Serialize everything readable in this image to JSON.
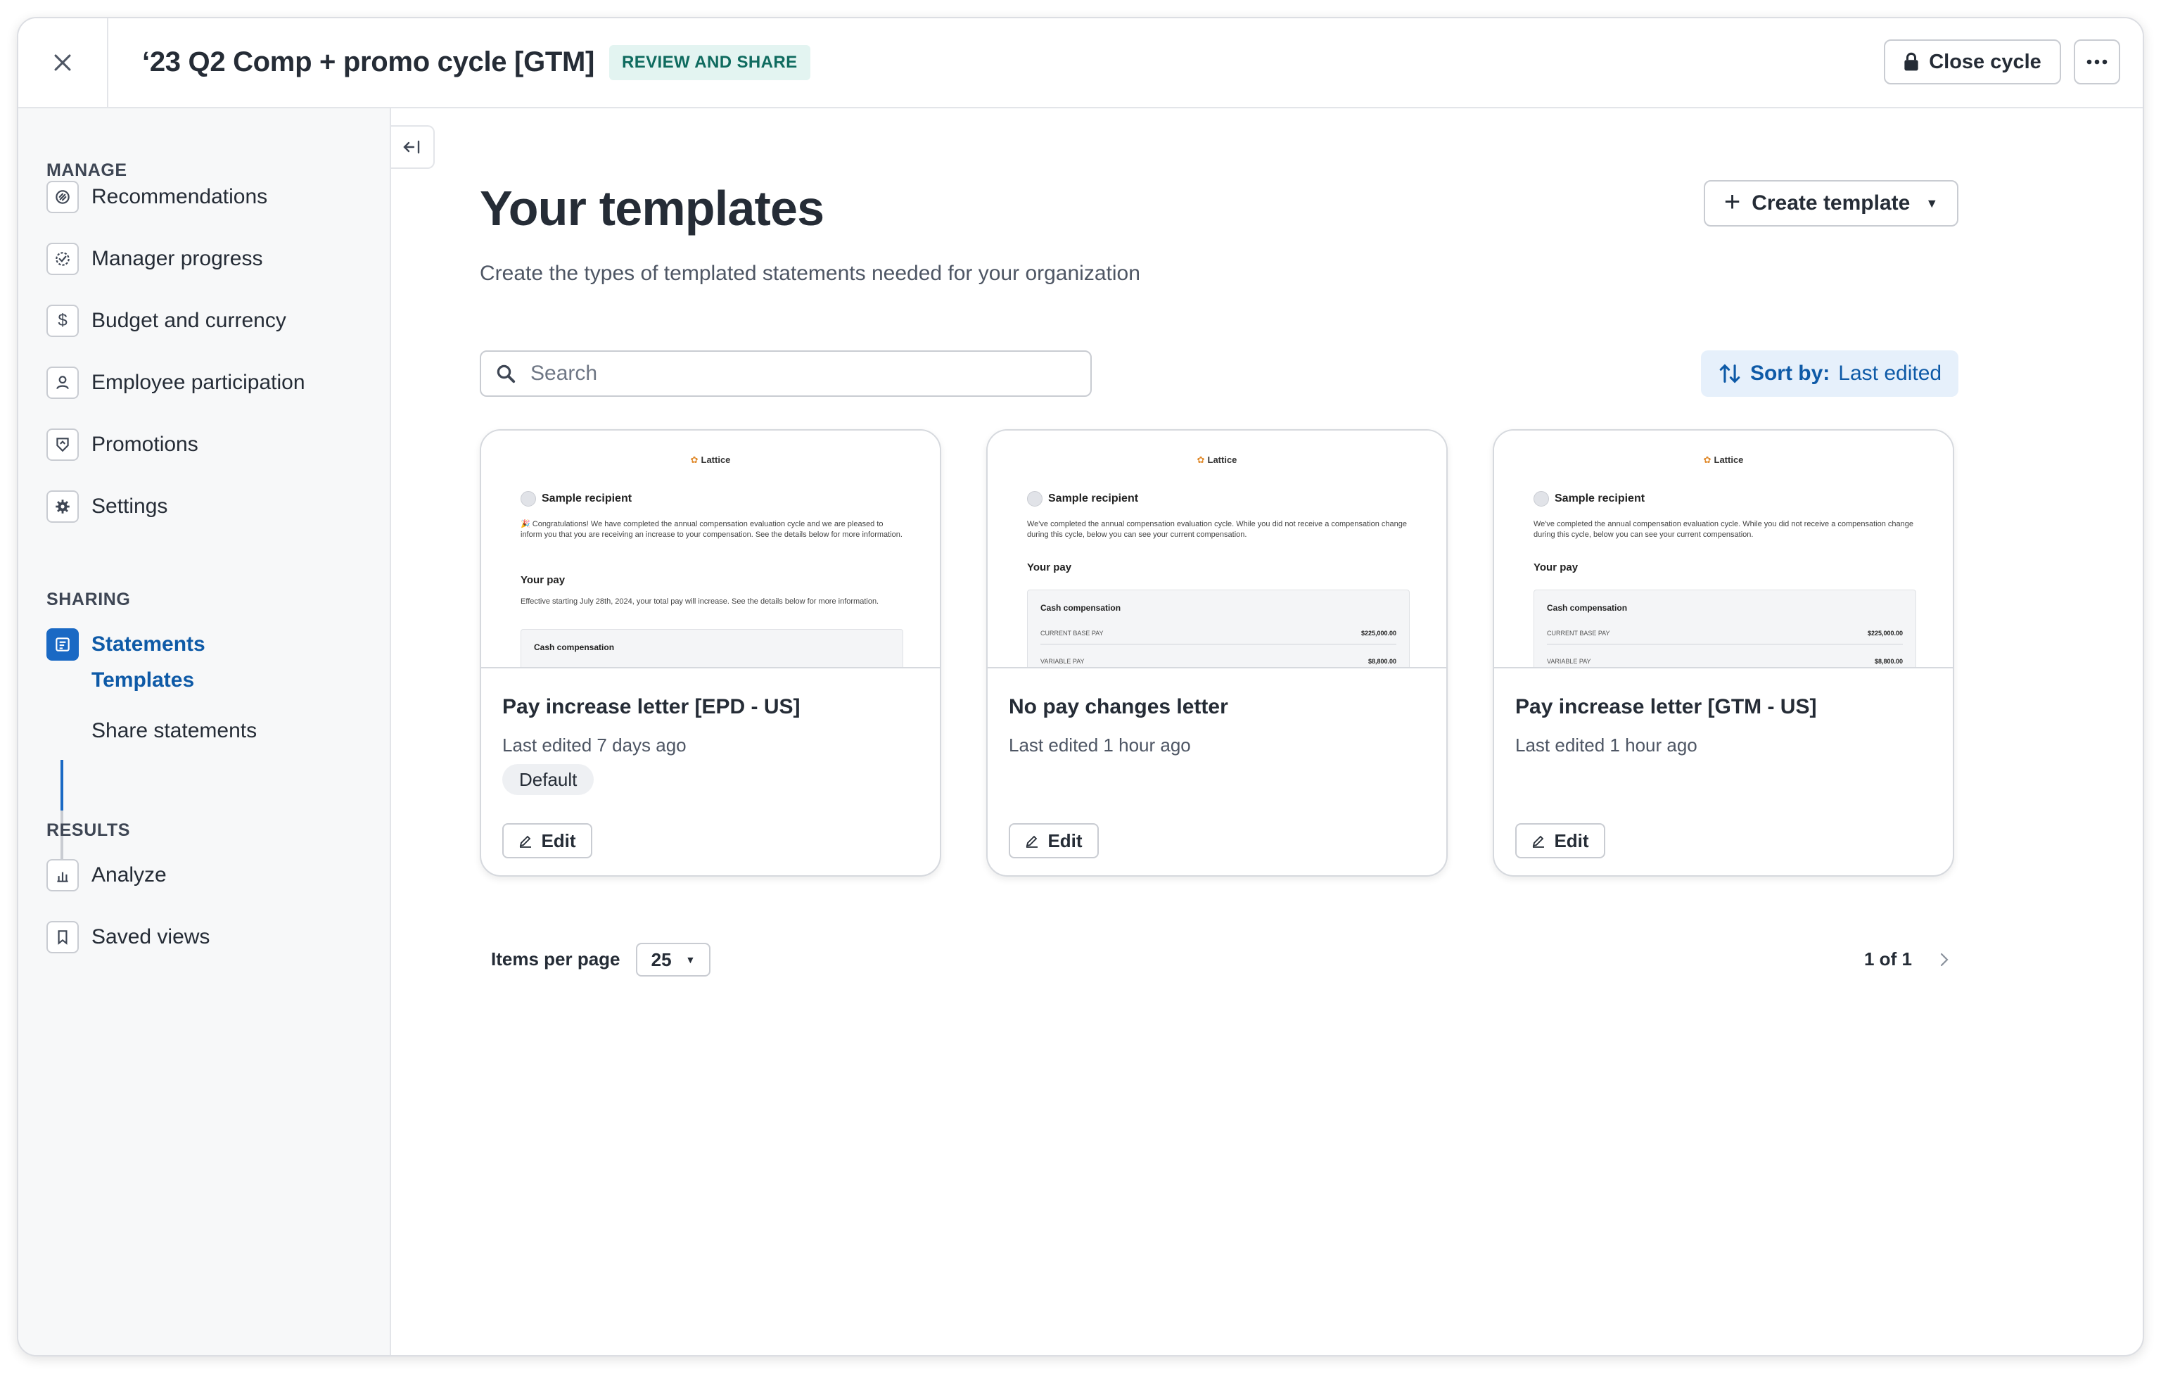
{
  "header": {
    "close_icon": "close-icon",
    "title": "‘23 Q2 Comp + promo cycle [GTM]",
    "status": "REVIEW AND SHARE",
    "close_cycle_label": "Close cycle",
    "more_icon": "more-horizontal-icon"
  },
  "sidebar": {
    "manage_label": "MANAGE",
    "manage_items": [
      {
        "label": "Recommendations",
        "icon": "link-icon"
      },
      {
        "label": "Manager progress",
        "icon": "progress-check-icon"
      },
      {
        "label": "Budget and currency",
        "icon": "dollar-icon"
      },
      {
        "label": "Employee participation",
        "icon": "person-icon"
      },
      {
        "label": "Promotions",
        "icon": "promotion-badge-icon"
      },
      {
        "label": "Settings",
        "icon": "gear-icon"
      }
    ],
    "sharing_label": "SHARING",
    "statements_label": "Statements",
    "subnav": [
      {
        "label": "Templates",
        "active": true
      },
      {
        "label": "Share statements",
        "active": false
      }
    ],
    "results_label": "RESULTS",
    "results_items": [
      {
        "label": "Analyze",
        "icon": "bar-chart-icon"
      },
      {
        "label": "Saved views",
        "icon": "bookmark-icon"
      }
    ]
  },
  "main": {
    "title": "Your templates",
    "subtitle": "Create the types of templated statements needed for your organization",
    "create_label": "Create template",
    "search_placeholder": "Search",
    "sort_prefix": "Sort by:",
    "sort_value": "Last edited",
    "cards": [
      {
        "title": "Pay increase letter [EPD - US]",
        "edited": "Last edited 7 days ago",
        "badge": "Default",
        "edit_label": "Edit",
        "preview": {
          "logo": "Lattice",
          "recipient": "Sample recipient",
          "intro": "🎉 Congratulations! We have completed the annual compensation evaluation cycle and we are pleased to inform you that you are receiving an increase to your compensation. See the details below for more information.",
          "section": "Your pay",
          "section_text": "Effective starting July 28th, 2024, your total pay will increase. See the details below for more information.",
          "box_title": "Cash compensation"
        }
      },
      {
        "title": "No pay changes letter",
        "edited": "Last edited 1 hour ago",
        "edit_label": "Edit",
        "preview": {
          "logo": "Lattice",
          "recipient": "Sample recipient",
          "intro": "We've completed the annual compensation evaluation cycle. While you did not receive a compensation change during this cycle, below you can see your current compensation.",
          "section": "Your pay",
          "box_title": "Cash compensation",
          "row1_label": "CURRENT BASE PAY",
          "row1_value": "$225,000.00",
          "row2_label": "VARIABLE PAY",
          "row2_value": "$8,800.00"
        }
      },
      {
        "title": "Pay increase letter [GTM - US]",
        "edited": "Last edited 1 hour ago",
        "edit_label": "Edit",
        "preview": {
          "logo": "Lattice",
          "recipient": "Sample recipient",
          "intro": "We've completed the annual compensation evaluation cycle. While you did not receive a compensation change during this cycle, below you can see your current compensation.",
          "section": "Your pay",
          "box_title": "Cash compensation",
          "row1_label": "CURRENT BASE PAY",
          "row1_value": "$225,000.00",
          "row2_label": "VARIABLE PAY",
          "row2_value": "$8,800.00"
        }
      }
    ]
  },
  "pagination": {
    "items_per_page_label": "Items per page",
    "items_per_page_value": "25",
    "page_count": "1 of 1"
  },
  "colors": {
    "accent": "#1a69c4",
    "badge_bg": "#e3f4f1",
    "badge_text": "#0f6b5f",
    "sort_bg": "#e6f0fb"
  }
}
